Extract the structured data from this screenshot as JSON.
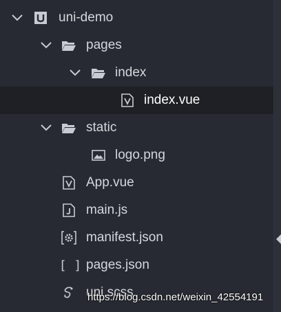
{
  "tree": {
    "project": {
      "label": "uni-demo",
      "icon": "project-icon"
    },
    "pages_folder": {
      "label": "pages",
      "icon": "folder-open-icon"
    },
    "index_folder": {
      "label": "index",
      "icon": "folder-open-icon"
    },
    "index_vue": {
      "label": "index.vue",
      "icon": "vue-file-icon"
    },
    "static_folder": {
      "label": "static",
      "icon": "folder-open-icon"
    },
    "logo_png": {
      "label": "logo.png",
      "icon": "image-file-icon"
    },
    "app_vue": {
      "label": "App.vue",
      "icon": "vue-file-icon"
    },
    "main_js": {
      "label": "main.js",
      "icon": "js-file-icon"
    },
    "manifest_json": {
      "label": "manifest.json",
      "icon": "settings-file-icon"
    },
    "pages_json": {
      "label": "pages.json",
      "icon": "brackets-file-icon",
      "glyph": "[ ]"
    },
    "uni_scss": {
      "label": "uni.scss",
      "icon": "sass-file-icon"
    }
  },
  "selected_item": "index.vue",
  "watermark": "https://blog.csdn.net/weixin_42554191",
  "colors": {
    "background": "#272a32",
    "selected_row": "#1e2026",
    "text": "#d4d7dc",
    "icon": "#c8cbd1"
  }
}
